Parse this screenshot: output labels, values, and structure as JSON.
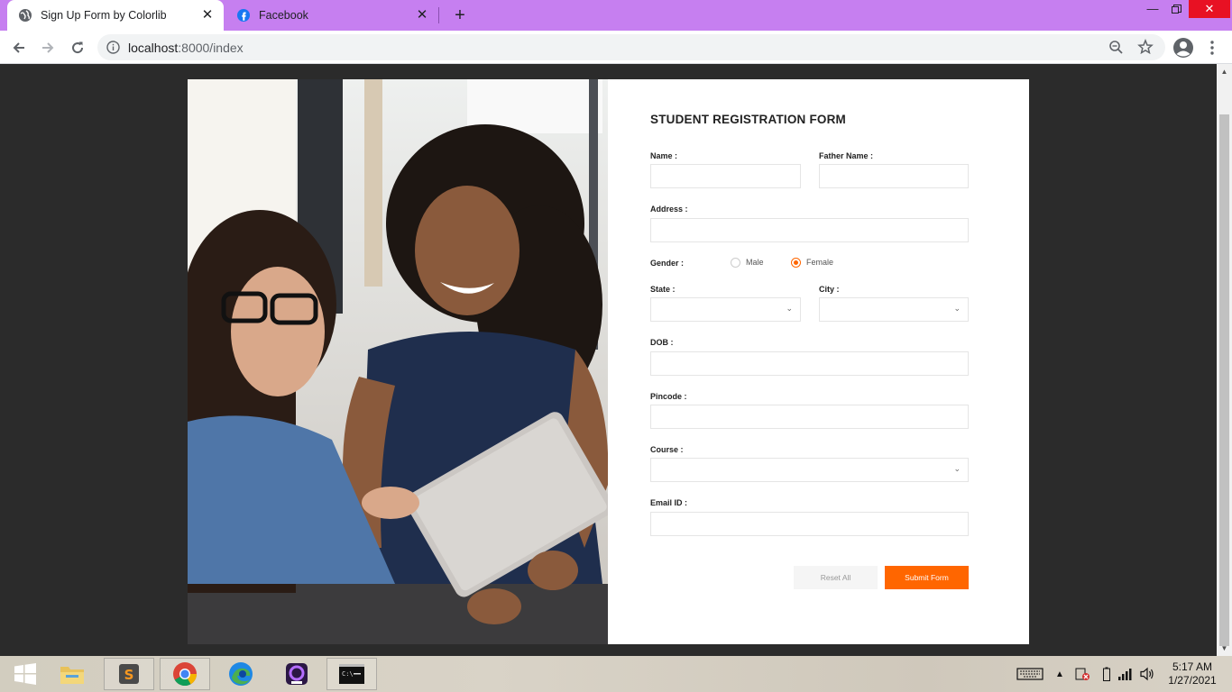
{
  "browser": {
    "tabs": [
      {
        "title": "Sign Up Form by Colorlib",
        "active": true
      },
      {
        "title": "Facebook",
        "active": false
      }
    ],
    "url_host": "localhost",
    "url_port_path": ":8000/index"
  },
  "form": {
    "title": "STUDENT REGISTRATION FORM",
    "name_label": "Name :",
    "father_name_label": "Father Name :",
    "address_label": "Address :",
    "gender_label": "Gender :",
    "gender_options": [
      "Male",
      "Female"
    ],
    "gender_selected": "Female",
    "state_label": "State :",
    "city_label": "City :",
    "dob_label": "DOB :",
    "pincode_label": "Pincode :",
    "course_label": "Course :",
    "email_label": "Email ID :",
    "reset_label": "Reset All",
    "submit_label": "Submit Form",
    "accent_color": "#ff6600"
  },
  "taskbar": {
    "apps": [
      "windows-start",
      "file-explorer",
      "sublime-text",
      "chrome",
      "edge",
      "app-purple",
      "command-prompt"
    ],
    "time": "5:17 AM",
    "date": "1/27/2021"
  }
}
